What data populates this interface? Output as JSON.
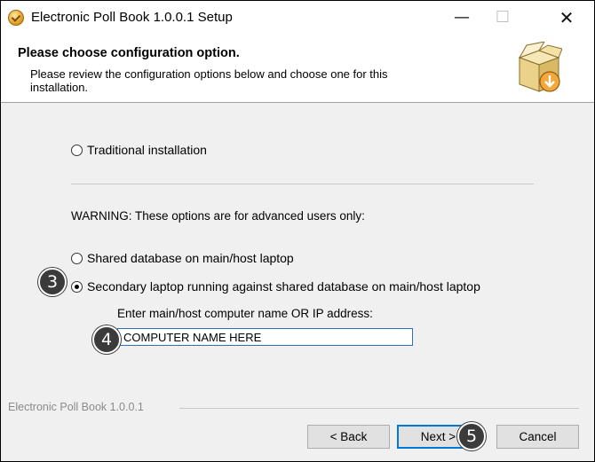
{
  "window": {
    "title": "Electronic Poll Book 1.0.0.1 Setup",
    "minimize_glyph": "—",
    "maximize_glyph": "☐",
    "close_glyph": "✕"
  },
  "header": {
    "title": "Please choose configuration option.",
    "subtitle": "Please review the configuration options below and choose one for this installation."
  },
  "options": {
    "traditional": {
      "label": "Traditional installation",
      "selected": false
    },
    "warning": "WARNING: These options are for advanced users only:",
    "shared": {
      "label": "Shared database on main/host laptop",
      "selected": false
    },
    "secondary": {
      "label": "Secondary laptop running against shared database on main/host laptop",
      "selected": true
    }
  },
  "host_field": {
    "label": "Enter main/host computer name OR IP address:",
    "value": "COMPUTER NAME HERE"
  },
  "badges": {
    "step3": "3",
    "step4": "4",
    "step5": "5"
  },
  "footer": {
    "brand": "Electronic Poll Book 1.0.0.1",
    "back_label": "< Back",
    "next_label": "Next >",
    "cancel_label": "Cancel"
  },
  "colors": {
    "badge": "#3b3b3b",
    "focus": "#0078d7"
  },
  "icons": {
    "app": "setup-disc-icon",
    "header": "installer-box-icon"
  }
}
